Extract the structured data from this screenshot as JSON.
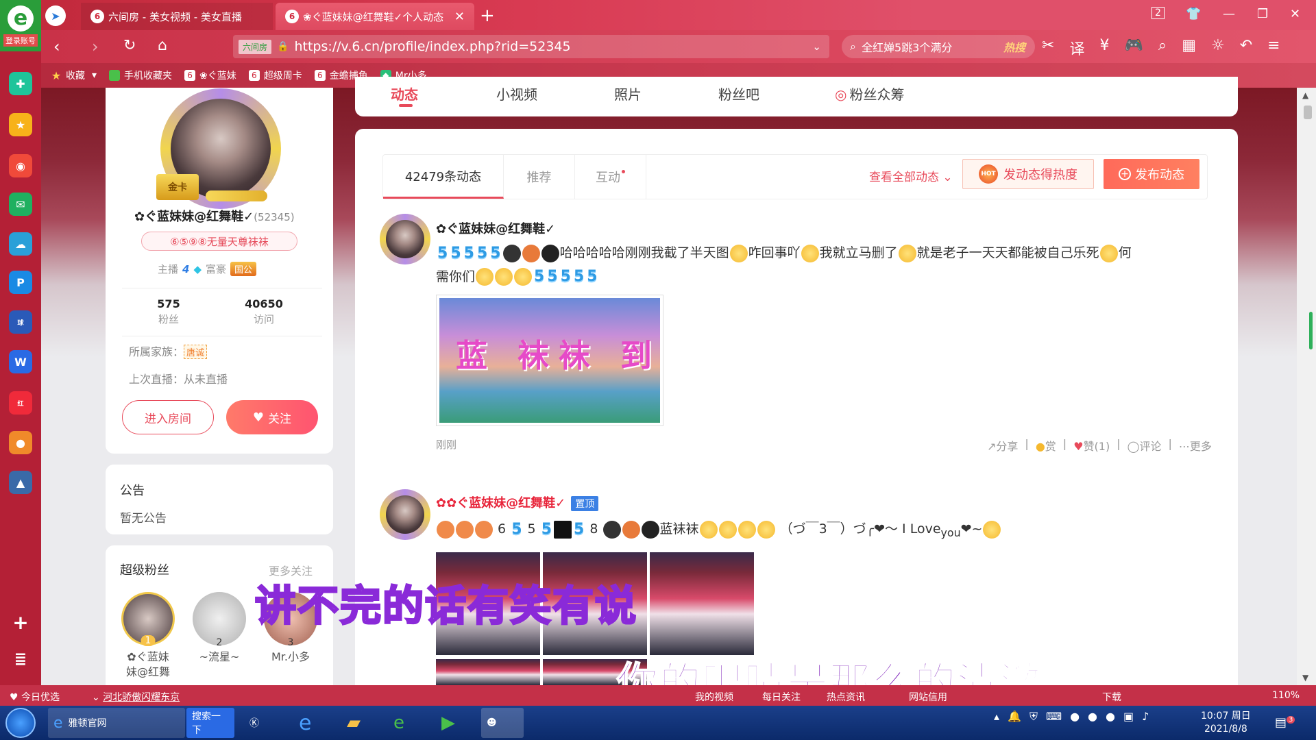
{
  "browser": {
    "login_label": "登录账号",
    "tabs": [
      {
        "title": "六间房 - 美女视频 - 美女直播"
      },
      {
        "title": "❀ぐ蓝妹妹@红舞鞋✓个人动态"
      }
    ],
    "url": "https://v.6.cn/profile/index.php?rid=52345",
    "site_chip": "六间房",
    "search_text": "全红婵5跳3个满分",
    "search_hot": "热搜",
    "bookmarks": [
      "收藏",
      "手机收藏夹",
      "❀ぐ蓝妹",
      "超级周卡",
      "金蟾捕鱼",
      "Mr小多"
    ],
    "tab_count": "2"
  },
  "profile": {
    "gold_card": "金卡",
    "name": "✿ぐ蓝妹妹@红舞鞋✓",
    "rid": "(52345)",
    "badge": "⑥⑤⑨⑧无量天尊袜袜",
    "anchor_label": "主播",
    "anchor_level": "4",
    "rich_label": "富豪",
    "rich_tag": "国公",
    "fans_count": "575",
    "fans_label": "粉丝",
    "visits_count": "40650",
    "visits_label": "访问",
    "family_label": "所属家族：",
    "family_tag": "唐诚",
    "last_live": "上次直播：从未直播",
    "enter_room": "进入房间",
    "follow": "关注"
  },
  "notice": {
    "title": "公告",
    "text": "暂无公告"
  },
  "super_fans": {
    "title": "超级粉丝",
    "more": "更多关注",
    "fans": [
      {
        "rank": "1",
        "name": "✿ぐ蓝妹\n妹@红舞"
      },
      {
        "rank": "2",
        "name": "~流星~"
      },
      {
        "rank": "3",
        "name": "Mr.小多"
      }
    ]
  },
  "topnav": {
    "tabs": [
      "动态",
      "小视频",
      "照片",
      "粉丝吧",
      "粉丝众筹"
    ]
  },
  "feed": {
    "subtabs": [
      "42479条动态",
      "推荐",
      "互动"
    ],
    "view_all": "查看全部动态",
    "hot_button": "发动态得热度",
    "hot_icon_text": "HOT",
    "post_button": "发布动态",
    "posts": [
      {
        "author": "✿ぐ蓝妹妹@红舞鞋✓",
        "text_a": "哈哈哈哈哈刚刚我截了半天图",
        "text_b": "咋回事吖",
        "text_c": "我就立马删了",
        "text_d": "就是老子一天天都能被自己乐死",
        "text_e": "何",
        "text_f": "需你们",
        "image_text": "蓝 袜袜 到",
        "time": "刚刚",
        "actions": {
          "share": "分享",
          "reward": "赏",
          "like": "赞(1)",
          "comment": "评论",
          "more": "更多"
        }
      },
      {
        "author": "✿ぐ蓝妹妹@红舞鞋✓",
        "pin": "置顶",
        "text_a": "6",
        "text_b": "5",
        "text_c": "8",
        "text_d": "蓝袜袜",
        "text_e": "（づ￣3￣）づ╭❤～ I  Love",
        "text_sub": "you",
        "text_f": "❤~"
      }
    ]
  },
  "subtitles": {
    "line1": "讲不完的话有笑有说",
    "line2": "你的眼睛是那么的清澈"
  },
  "statusbar": {
    "left1": "今日优选",
    "left2": "河北骄傲闪耀东京",
    "items": [
      "我的视频",
      "每日关注",
      "热点资讯",
      "网站信用",
      "下载"
    ],
    "zoom": "110%"
  },
  "taskbar": {
    "apps": [
      "雅顿官网",
      "搜索一下"
    ],
    "time": "10:07 周日",
    "date": "2021/8/8",
    "notify_count": "3"
  },
  "colors": {
    "accent": "#e84a5a",
    "brand_red": "#c43048",
    "blue": "#3b80e4"
  }
}
